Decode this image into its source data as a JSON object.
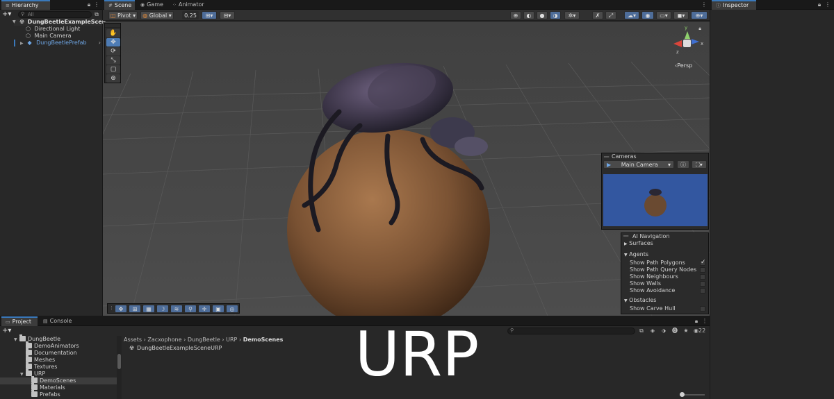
{
  "hierarchy": {
    "tab_label": "Hierarchy",
    "search_placeholder": "All",
    "scene_name": "DungBeetleExampleScen",
    "items": [
      "Directional Light",
      "Main Camera",
      "DungBeetlePrefab"
    ]
  },
  "scene_tabs": [
    "Scene",
    "Game",
    "Animator"
  ],
  "scene_toolbar": {
    "pivot": "Pivot",
    "global": "Global",
    "snap_value": "0.25"
  },
  "gizmo": {
    "projection": "Persp",
    "axes": [
      "y",
      "x",
      "z"
    ]
  },
  "cameras_overlay": {
    "title": "Cameras",
    "selected": "Main Camera"
  },
  "ai_navigation": {
    "title": "AI Navigation",
    "surfaces": "Surfaces",
    "agents": "Agents",
    "agent_options": [
      {
        "label": "Show Path Polygons",
        "checked": true
      },
      {
        "label": "Show Path Query Nodes",
        "checked": false
      },
      {
        "label": "Show Neighbours",
        "checked": false
      },
      {
        "label": "Show Walls",
        "checked": false
      },
      {
        "label": "Show Avoidance",
        "checked": false
      }
    ],
    "obstacles": "Obstacles",
    "obstacle_options": [
      {
        "label": "Show Carve Hull",
        "checked": false
      }
    ]
  },
  "inspector": {
    "tab_label": "Inspector"
  },
  "project": {
    "tab_project": "Project",
    "tab_console": "Console",
    "tree": [
      {
        "label": "DungBeetle",
        "level": 0,
        "expanded": true
      },
      {
        "label": "DemoAnimators",
        "level": 1
      },
      {
        "label": "Documentation",
        "level": 1
      },
      {
        "label": "Meshes",
        "level": 1
      },
      {
        "label": "Textures",
        "level": 1
      },
      {
        "label": "URP",
        "level": 1,
        "expanded": true
      },
      {
        "label": "DemoScenes",
        "level": 2,
        "selected": true
      },
      {
        "label": "Materials",
        "level": 2
      },
      {
        "label": "Prefabs",
        "level": 2
      }
    ],
    "breadcrumb": [
      "Assets",
      "Zacxophone",
      "DungBeetle",
      "URP",
      "DemoScenes"
    ],
    "files": [
      "DungBeetleExampleSceneURP"
    ],
    "badge_count": "22"
  },
  "watermark": "URP",
  "colors": {
    "accent": "#3a79bb",
    "prefab_blue": "#6fa7e6",
    "camera_preview_bg": "#3357a0"
  }
}
